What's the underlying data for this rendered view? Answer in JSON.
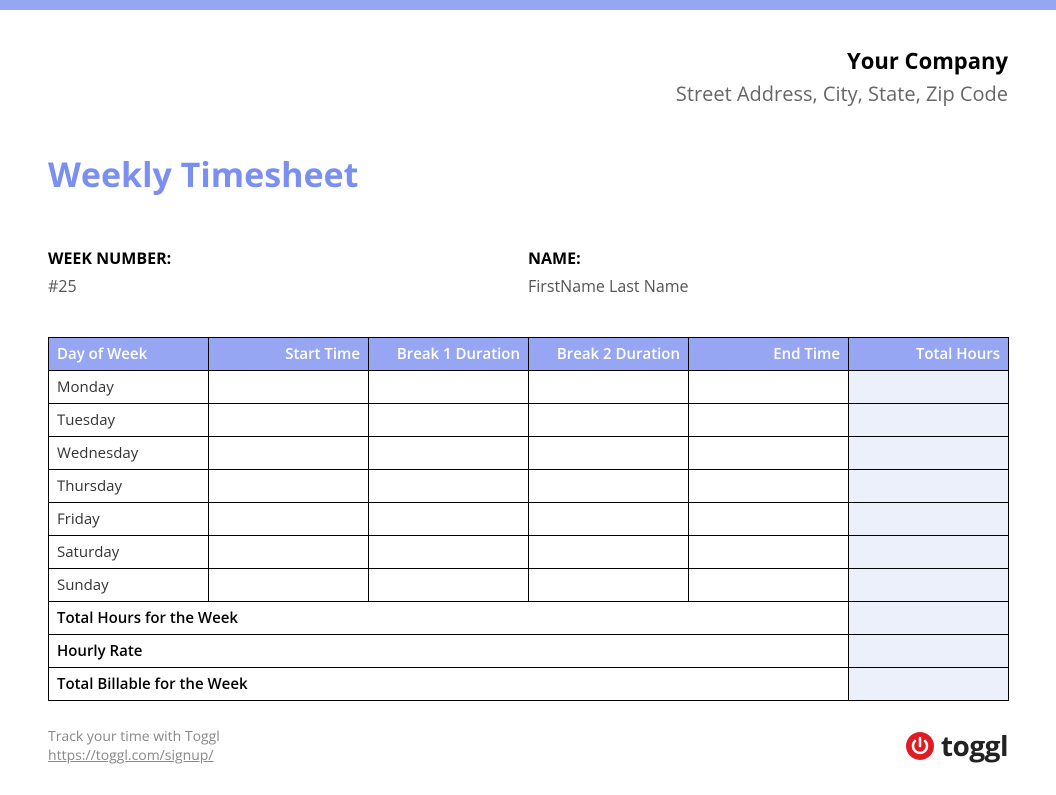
{
  "company": {
    "name": "Your Company",
    "address": "Street Address, City, State, Zip Code"
  },
  "title": "Weekly Timesheet",
  "info": {
    "week_label": "WEEK NUMBER:",
    "week_value": "#25",
    "name_label": "NAME:",
    "name_value": "FirstName Last Name"
  },
  "table": {
    "headers": [
      "Day of Week",
      "Start Time",
      "Break 1 Duration",
      "Break 2 Duration",
      "End Time",
      "Total Hours"
    ],
    "days": [
      "Monday",
      "Tuesday",
      "Wednesday",
      "Thursday",
      "Friday",
      "Saturday",
      "Sunday"
    ],
    "rows": [
      {
        "start": "",
        "break1": "",
        "break2": "",
        "end": "",
        "total": ""
      },
      {
        "start": "",
        "break1": "",
        "break2": "",
        "end": "",
        "total": ""
      },
      {
        "start": "",
        "break1": "",
        "break2": "",
        "end": "",
        "total": ""
      },
      {
        "start": "",
        "break1": "",
        "break2": "",
        "end": "",
        "total": ""
      },
      {
        "start": "",
        "break1": "",
        "break2": "",
        "end": "",
        "total": ""
      },
      {
        "start": "",
        "break1": "",
        "break2": "",
        "end": "",
        "total": ""
      },
      {
        "start": "",
        "break1": "",
        "break2": "",
        "end": "",
        "total": ""
      }
    ],
    "summary": [
      {
        "label": "Total Hours for the Week",
        "value": ""
      },
      {
        "label": "Hourly Rate",
        "value": ""
      },
      {
        "label": "Total Billable for the Week",
        "value": ""
      }
    ]
  },
  "footer": {
    "track_text": "Track your time with Toggl",
    "link_text": "https://toggl.com/signup/",
    "brand": "toggl"
  }
}
